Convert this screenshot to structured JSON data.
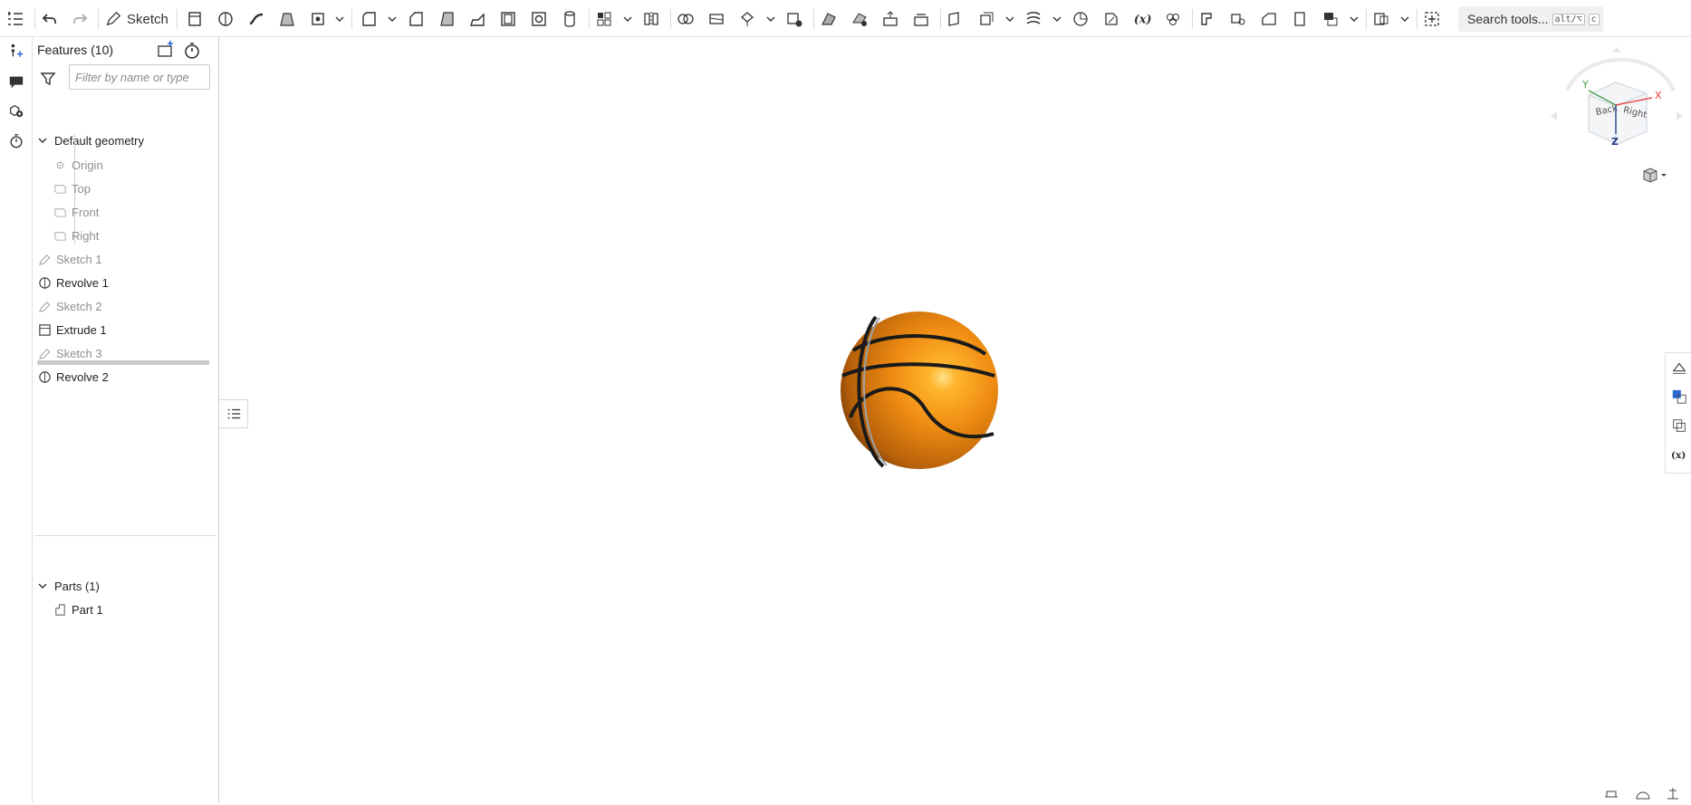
{
  "toolbar": {
    "sketch_label": "Sketch",
    "search_label": "Search tools...",
    "search_shortcut_1": "alt/⌥",
    "search_shortcut_2": "c",
    "tools": [
      "undo-icon",
      "redo-icon",
      "sketch-pencil-icon",
      "extrude-icon",
      "revolve-icon",
      "sweep-icon",
      "loft-icon",
      "thicken-icon",
      "fillet-icon",
      "chamfer-icon",
      "draft-icon",
      "rib-icon",
      "shell-icon",
      "hole-icon",
      "cylinder-icon",
      "linear-pattern-icon",
      "mirror-icon",
      "boolean-icon",
      "split-icon",
      "transform-icon",
      "delete-part-icon",
      "modify-fillet-icon",
      "delete-face-icon",
      "move-face-icon",
      "replace-face-icon",
      "offset-surface-icon",
      "plane-icon",
      "mate-connector-icon",
      "helix-icon",
      "measure-icon",
      "variable-icon",
      "composite-icon",
      "sheet-metal-icon",
      "frame-icon",
      "bend-icon",
      "flange-icon",
      "table-icon",
      "drawing-icon",
      "add-custom-feature-icon"
    ]
  },
  "left_strip": [
    "feature-list-icon",
    "add-feature-icon",
    "comment-icon",
    "parts-icon",
    "history-icon"
  ],
  "features_panel": {
    "title": "Features (10)",
    "filter_placeholder": "Filter by name or type",
    "default_geometry": "Default geometry",
    "origin": "Origin",
    "planes": [
      "Top",
      "Front",
      "Right"
    ],
    "features": [
      {
        "label": "Sketch 1",
        "icon": "sketch-pencil-icon",
        "state": "grey"
      },
      {
        "label": "Revolve 1",
        "icon": "revolve-icon",
        "state": "dark"
      },
      {
        "label": "Sketch 2",
        "icon": "sketch-pencil-icon",
        "state": "grey"
      },
      {
        "label": "Extrude 1",
        "icon": "extrude-icon",
        "state": "dark"
      },
      {
        "label": "Sketch 3",
        "icon": "sketch-pencil-icon",
        "state": "grey"
      },
      {
        "label": "Revolve 2",
        "icon": "revolve-icon",
        "state": "dark"
      }
    ],
    "parts_header": "Parts (1)",
    "parts": [
      "Part 1"
    ]
  },
  "viewcube": {
    "axis_x": "X",
    "axis_y": "Y",
    "axis_z": "Z",
    "face_right": "Right",
    "face_back": "Back"
  },
  "colors": {
    "ball": "#e07d10",
    "axis_x": "#e53935",
    "axis_y": "#43a047",
    "axis_z": "#1e3a8a"
  },
  "right_strip": [
    "appearance-icon",
    "view-parts-icon",
    "section-view-icon",
    "configuration-icon"
  ],
  "bottom_right": [
    "measure-tool-icon",
    "render-icon",
    "mass-props-icon"
  ]
}
